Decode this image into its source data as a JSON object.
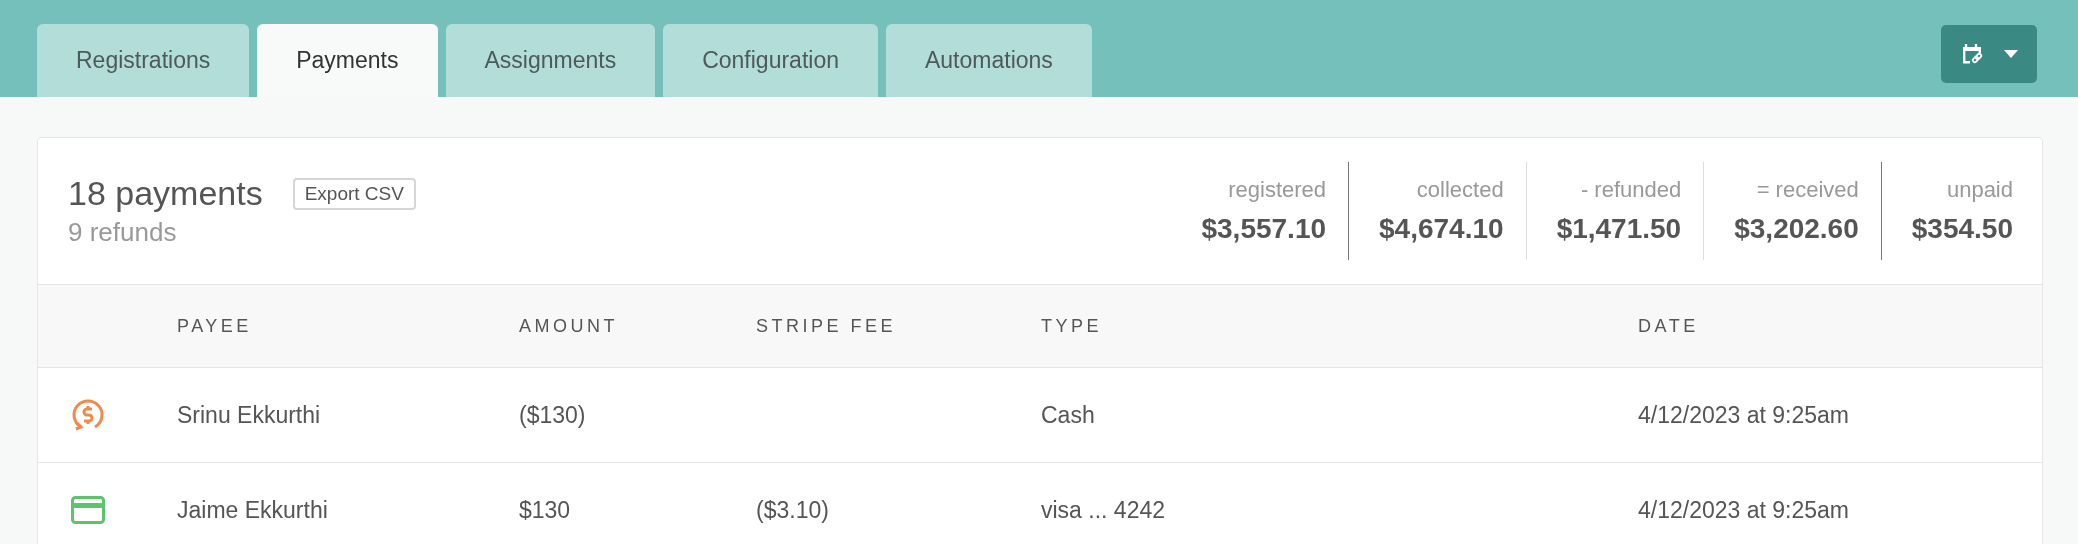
{
  "tabs": [
    {
      "label": "Registrations",
      "selected": false
    },
    {
      "label": "Payments",
      "selected": true
    },
    {
      "label": "Assignments",
      "selected": false
    },
    {
      "label": "Configuration",
      "selected": false
    },
    {
      "label": "Automations",
      "selected": false
    }
  ],
  "summary": {
    "title": "18 payments",
    "subtitle": "9 refunds",
    "export_button": "Export CSV",
    "stats": [
      {
        "label": "registered",
        "value": "$3,557.10"
      },
      {
        "label": "collected",
        "value": "$4,674.10"
      },
      {
        "label": "- refunded",
        "value": "$1,471.50"
      },
      {
        "label": "= received",
        "value": "$3,202.60"
      },
      {
        "label": "unpaid",
        "value": "$354.50"
      }
    ]
  },
  "table": {
    "columns": [
      "PAYEE",
      "AMOUNT",
      "STRIPE FEE",
      "TYPE",
      "DATE"
    ],
    "rows": [
      {
        "kind": "refund",
        "payee": "Srinu Ekkurthi",
        "amount": "($130)",
        "stripe_fee": "",
        "type": "Cash",
        "date": "4/12/2023 at 9:25am"
      },
      {
        "kind": "card",
        "payee": "Jaime Ekkurthi",
        "amount": "$130",
        "stripe_fee": "($3.10)",
        "type": "visa ... 4242",
        "date": "4/12/2023 at 9:25am"
      }
    ]
  }
}
